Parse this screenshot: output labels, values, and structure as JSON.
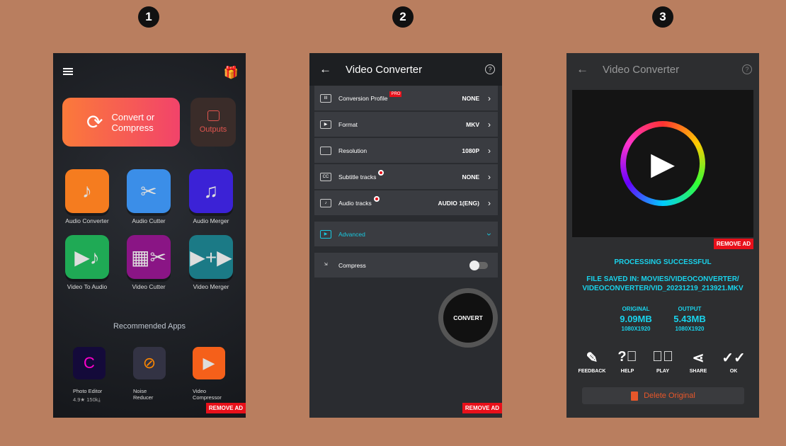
{
  "steps": [
    "1",
    "2",
    "3"
  ],
  "screen1": {
    "convert_label": "Convert or Compress",
    "outputs_label": "Outputs",
    "tools": [
      {
        "label": "Audio Converter",
        "color": "#f57c1f",
        "icon": "music-note-icon"
      },
      {
        "label": "Audio Cutter",
        "color": "#3b8ee8",
        "icon": "scissors-music-icon"
      },
      {
        "label": "Audio Merger",
        "color": "#3b22d6",
        "icon": "music-notes-icon"
      },
      {
        "label": "Video To Audio",
        "color": "#1faa55",
        "icon": "film-music-icon"
      },
      {
        "label": "Video Cutter",
        "color": "#8a1585",
        "icon": "film-scissors-icon"
      },
      {
        "label": "Video Merger",
        "color": "#1b7a86",
        "icon": "film-merge-icon"
      }
    ],
    "recommended_title": "Recommended Apps",
    "apps": [
      {
        "name": "Photo Editor",
        "meta": "4.9★   150k⤓"
      },
      {
        "name": "Noise Reducer",
        "meta": ""
      },
      {
        "name": "Video Compressor",
        "meta": ""
      }
    ],
    "remove_ad": "REMOVE AD"
  },
  "screen2": {
    "title": "Video Converter",
    "rows": [
      {
        "label": "Conversion Profile",
        "value": "NONE",
        "badge": "PRO"
      },
      {
        "label": "Format",
        "value": "MKV"
      },
      {
        "label": "Resolution",
        "value": "1080P"
      },
      {
        "label": "Subtitle tracks",
        "value": "NONE"
      },
      {
        "label": "Audio tracks",
        "value": "AUDIO 1(ENG)"
      }
    ],
    "advanced": "Advanced",
    "compress": "Compress",
    "compress_on": false,
    "convert": "CONVERT",
    "remove_ad": "REMOVE AD"
  },
  "screen3": {
    "title": "Video Converter",
    "remove_ad": "REMOVE AD",
    "status": "PROCESSING SUCCESSFUL",
    "saved_line1": "FILE SAVED IN: MOVIES/VIDEOCONVERTER/",
    "saved_line2": "VIDEOCONVERTER/VID_20231219_213921.MKV",
    "original": {
      "label": "ORIGINAL",
      "size": "9.09MB",
      "res": "1080X1920"
    },
    "output": {
      "label": "OUTPUT",
      "size": "5.43MB",
      "res": "1080X1920"
    },
    "actions": [
      "FEEDBACK",
      "HELP",
      "PLAY",
      "SHARE",
      "OK"
    ],
    "delete": "Delete Original"
  }
}
